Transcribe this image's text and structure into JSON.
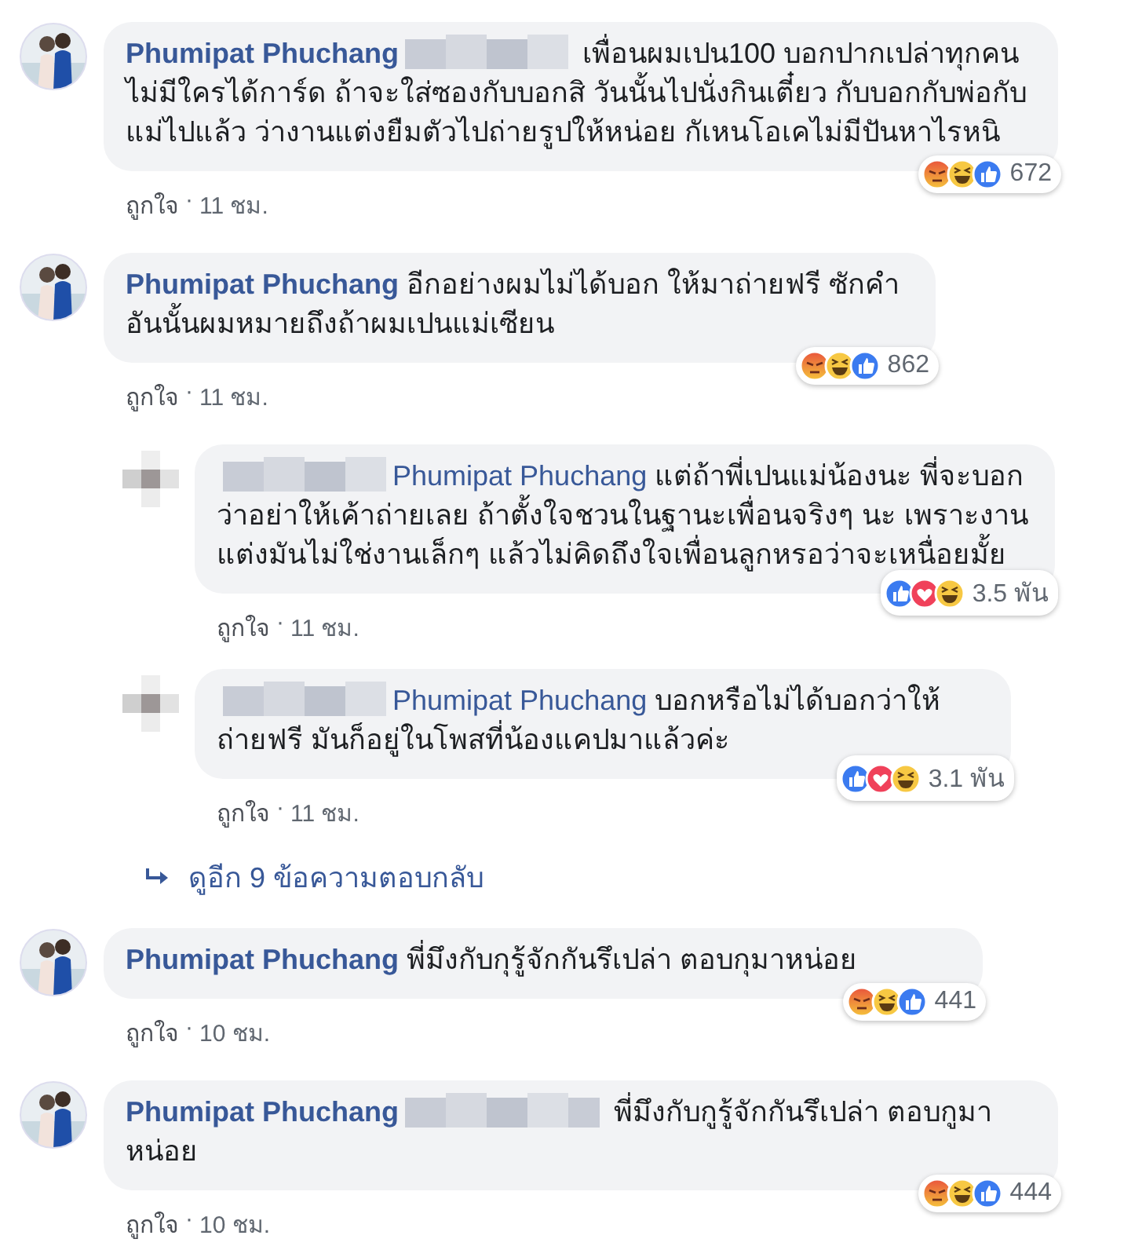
{
  "comments": [
    {
      "kind": "comment",
      "name": "Phumipat Phuchang",
      "blurred_before": false,
      "blurred_after": true,
      "text": "เพื่อนผมเปน100 บอกปากเปล่าทุกคน ไม่มีใครได้การ์ด ถ้าจะใส่ซองกับบอกสิ วันนั้นไปนั่งกินเตี๋ยว กับบอกกับพ่อกับแม่ไปแล้ว ว่างานแต่งยืมตัวไปถ่ายรูปให้หน่อย กัเหนโอเคไม่มีปันหาไรหนิ",
      "reactions": [
        {
          "kind": "angry"
        },
        {
          "kind": "haha"
        },
        {
          "kind": "like"
        }
      ],
      "count": "672",
      "like_label": "ถูกใจ",
      "separator": "·",
      "time": "11 ชม."
    },
    {
      "kind": "comment",
      "name": "Phumipat Phuchang",
      "blurred_before": false,
      "blurred_after": false,
      "text": "อีกอย่างผมไม่ได้บอก ให้มาถ่ายฟรี ซักคำ อันนั้นผมหมายถึงถ้าผมเปนแม่เซียน",
      "reactions": [
        {
          "kind": "angry"
        },
        {
          "kind": "haha"
        },
        {
          "kind": "like"
        }
      ],
      "count": "862",
      "like_label": "ถูกใจ",
      "separator": "·",
      "time": "11 ชม."
    },
    {
      "kind": "reply",
      "name": "Phumipat Phuchang",
      "blurred_before": true,
      "blurred_after": false,
      "text": "แต่ถ้าพี่เปนแม่น้องนะ พี่จะบอกว่าอย่าให้เค้าถ่ายเลย ถ้าตั้งใจชวนในฐานะเพื่อนจริงๆ นะ เพราะงานแต่งมันไม่ใช่งานเล็กๆ แล้วไม่คิดถึงใจเพื่อนลูกหรอว่าจะเหนื่อยมั้ย",
      "reactions": [
        {
          "kind": "like"
        },
        {
          "kind": "love"
        },
        {
          "kind": "haha"
        }
      ],
      "count": "3.5 พัน",
      "like_label": "ถูกใจ",
      "separator": "·",
      "time": "11 ชม."
    },
    {
      "kind": "reply",
      "name": "Phumipat Phuchang",
      "blurred_before": true,
      "blurred_after": false,
      "text": "บอกหรือไม่ได้บอกว่าให้ถ่ายฟรี มันก็อยู่ในโพสที่น้องแคปมาแล้วค่ะ",
      "reactions": [
        {
          "kind": "like"
        },
        {
          "kind": "love"
        },
        {
          "kind": "haha"
        }
      ],
      "count": "3.1 พัน",
      "like_label": "ถูกใจ",
      "separator": "·",
      "time": "11 ชม."
    },
    {
      "kind": "more",
      "text": "ดูอีก 9 ข้อความตอบกลับ"
    },
    {
      "kind": "comment",
      "name": "Phumipat Phuchang",
      "blurred_before": false,
      "blurred_after": false,
      "text": "พี่มึงกับกุรู้จักกันรึเปล่า ตอบกุมาหน่อย",
      "reactions": [
        {
          "kind": "angry"
        },
        {
          "kind": "haha"
        },
        {
          "kind": "like"
        }
      ],
      "count": "441",
      "like_label": "ถูกใจ",
      "separator": "·",
      "time": "10 ชม."
    },
    {
      "kind": "comment",
      "name": "Phumipat Phuchang",
      "blurred_before": false,
      "blurred_after": true,
      "text": "พี่มึงกับกูรู้จักกันรึเปล่า ตอบกูมาหน่อย",
      "reactions": [
        {
          "kind": "angry"
        },
        {
          "kind": "haha"
        },
        {
          "kind": "like"
        }
      ],
      "count": "444",
      "like_label": "ถูกใจ",
      "separator": "·",
      "time": "10 ชม."
    }
  ]
}
